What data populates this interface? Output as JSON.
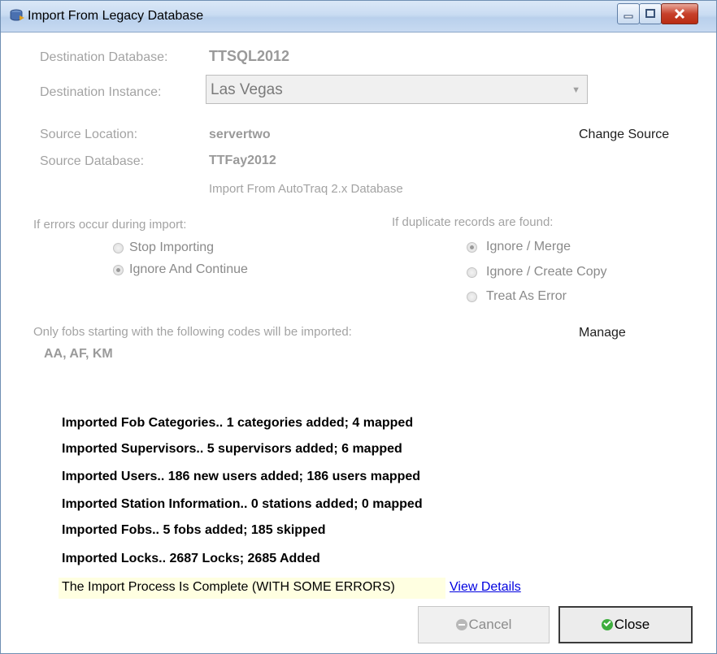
{
  "window": {
    "title": "Import From Legacy Database"
  },
  "destination": {
    "database_label": "Destination Database:",
    "database_value": "TTSQL2012",
    "instance_label": "Destination Instance:",
    "instance_value": "Las Vegas"
  },
  "source": {
    "location_label": "Source Location:",
    "location_value": "servertwo",
    "change_label": "Change Source",
    "database_label": "Source Database:",
    "database_value": "TTFay2012",
    "import_type": "Import From AutoTraq 2.x Database"
  },
  "errors_group": {
    "heading": "If errors occur during import:",
    "options": [
      {
        "label": "Stop Importing",
        "selected": false
      },
      {
        "label": "Ignore And Continue",
        "selected": true
      }
    ]
  },
  "duplicates_group": {
    "heading": "If duplicate records are found:",
    "options": [
      {
        "label": "Ignore / Merge",
        "selected": true
      },
      {
        "label": "Ignore / Create Copy",
        "selected": false
      },
      {
        "label": "Treat As Error",
        "selected": false
      }
    ]
  },
  "fobs": {
    "note": "Only fobs starting with the following codes will be imported:",
    "manage_label": "Manage",
    "codes": "AA, AF, KM"
  },
  "results": [
    "Imported Fob Categories..  1 categories added; 4 mapped",
    "Imported Supervisors..  5 supervisors added; 6 mapped",
    "Imported Users..  186 new users added; 186 users mapped",
    "Imported Station Information..  0 stations added; 0 mapped",
    "Imported Fobs..  5 fobs added; 185 skipped",
    "Imported Locks..  2687 Locks; 2685 Added"
  ],
  "status": {
    "message": "The Import Process Is Complete (WITH SOME ERRORS)",
    "details_link": "View Details"
  },
  "buttons": {
    "cancel": "Cancel",
    "close": "Close"
  },
  "icons": {
    "window": "database-import-icon",
    "cancel": "minus-circle-icon",
    "close": "check-circle-icon"
  }
}
